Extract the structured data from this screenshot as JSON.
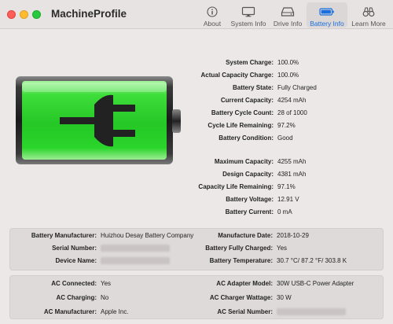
{
  "app": {
    "title": "MachineProfile"
  },
  "tabs": [
    {
      "label": "About",
      "icon": "info-icon",
      "active": false
    },
    {
      "label": "System Info",
      "icon": "display-icon",
      "active": false
    },
    {
      "label": "Drive Info",
      "icon": "drive-icon",
      "active": false
    },
    {
      "label": "Battery Info",
      "icon": "battery-icon",
      "active": true
    },
    {
      "label": "Learn More",
      "icon": "binoculars-icon",
      "active": false
    }
  ],
  "battery_graphic": {
    "icon": "power-plug-icon",
    "fill_fraction": 1.0,
    "fill_color": "#2fd12f"
  },
  "details": [
    {
      "label": "System Charge:",
      "value": "100.0%"
    },
    {
      "label": "Actual Capacity Charge:",
      "value": "100.0%"
    },
    {
      "label": "Battery State:",
      "value": "Fully Charged"
    },
    {
      "label": "Current Capacity:",
      "value": "4254 mAh"
    },
    {
      "label": "Battery Cycle Count:",
      "value": "28 of 1000"
    },
    {
      "label": "Cycle Life Remaining:",
      "value": "97.2%"
    },
    {
      "label": "Battery Condition:",
      "value": "Good"
    },
    {
      "label": "Maximum Capacity:",
      "value": "4255 mAh"
    },
    {
      "label": "Design Capacity:",
      "value": "4381 mAh"
    },
    {
      "label": "Capacity Life Remaining:",
      "value": "97.1%"
    },
    {
      "label": "Battery Voltage:",
      "value": "12.91 V"
    },
    {
      "label": "Battery Current:",
      "value": "0 mA"
    }
  ],
  "battery_panel": {
    "left": [
      {
        "label": "Battery Manufacturer:",
        "value": "Huizhou Desay Battery Company"
      },
      {
        "label": "Serial Number:",
        "value": ""
      },
      {
        "label": "Device Name:",
        "value": ""
      }
    ],
    "right": [
      {
        "label": "Manufacture Date:",
        "value": "2018-10-29"
      },
      {
        "label": "Battery Fully Charged:",
        "value": "Yes"
      },
      {
        "label": "Battery Temperature:",
        "value": "30.7 °C/ 87.2 °F/ 303.8 K"
      }
    ]
  },
  "ac_panel": {
    "left": [
      {
        "label": "AC Connected:",
        "value": "Yes"
      },
      {
        "label": "AC Charging:",
        "value": "No"
      },
      {
        "label": "AC Manufacturer:",
        "value": "Apple Inc."
      }
    ],
    "right": [
      {
        "label": "AC Adapter Model:",
        "value": "30W USB-C Power Adapter"
      },
      {
        "label": "AC Charger Wattage:",
        "value": "30 W"
      },
      {
        "label": "AC Serial Number:",
        "value": ""
      }
    ]
  }
}
